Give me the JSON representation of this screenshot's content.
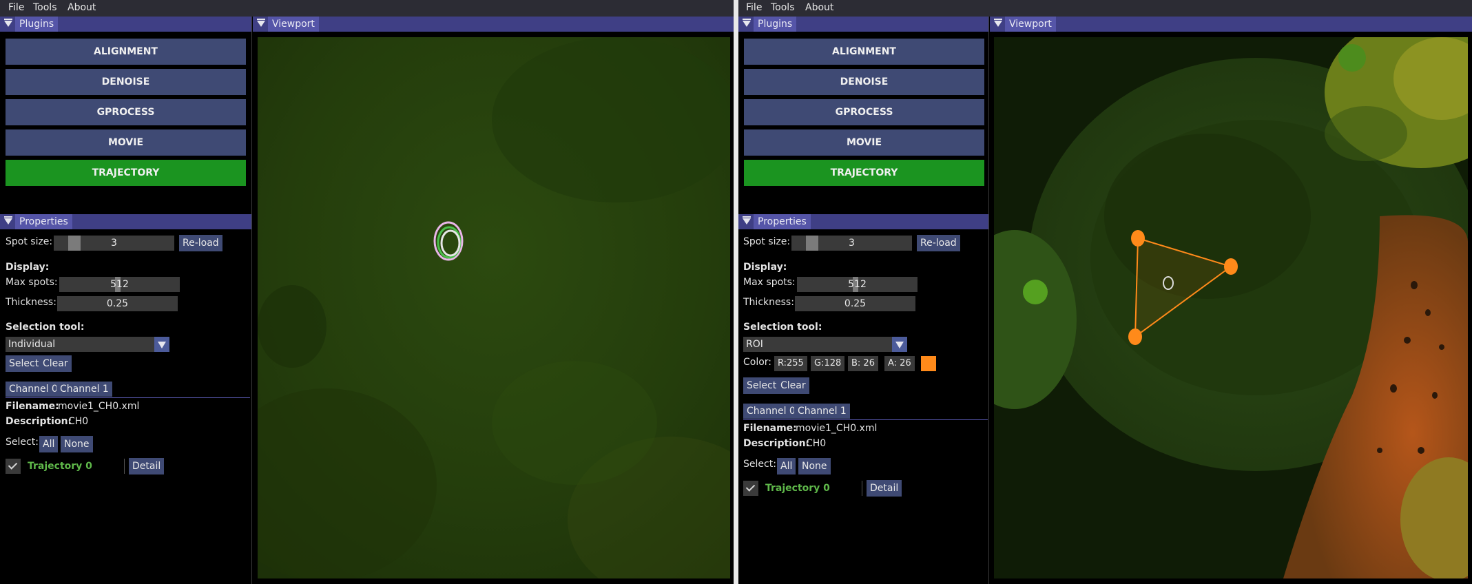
{
  "menu": {
    "file": "File",
    "tools": "Tools",
    "about": "About"
  },
  "windows": {
    "plugins": "Plugins",
    "viewport": "Viewport",
    "properties": "Properties"
  },
  "plugins": [
    "ALIGNMENT",
    "DENOISE",
    "GPROCESS",
    "MOVIE",
    "TRAJECTORY"
  ],
  "active_plugin": "TRAJECTORY",
  "accent_color": "#1b9420",
  "button_color": "#3f4a74",
  "title_color": "#5555a8",
  "left": {
    "spot_size_label": "Spot size:",
    "spot_size_value": "3",
    "reload_label": "Re-load",
    "display_label": "Display:",
    "max_spots_label": "Max spots:",
    "max_spots_value": "512",
    "thickness_label": "Thickness:",
    "thickness_value": "0.25",
    "selection_tool_label": "Selection tool:",
    "selection_tool_value": "Individual",
    "select_label": "Select",
    "clear_label": "Clear",
    "tabs": [
      "Channel 0",
      "Channel 1"
    ],
    "filename_label": "Filename:",
    "filename_value": "movie1_CH0.xml",
    "description_label": "Description:",
    "description_value": "CH0",
    "select_row_label": "Select:",
    "all_label": "All",
    "none_label": "None",
    "trajectory_label": "Trajectory 0",
    "trajectory_checked": true,
    "detail_label": "Detail"
  },
  "right": {
    "spot_size_label": "Spot size:",
    "spot_size_value": "3",
    "reload_label": "Re-load",
    "display_label": "Display:",
    "max_spots_label": "Max spots:",
    "max_spots_value": "512",
    "thickness_label": "Thickness:",
    "thickness_value": "0.25",
    "selection_tool_label": "Selection tool:",
    "selection_tool_value": "ROI",
    "color_label": "Color:",
    "color_r": "R:255",
    "color_g": "G:128",
    "color_b": "B: 26",
    "color_a": "A: 26",
    "roi_color": "#ff8a1a",
    "select_label": "Select",
    "clear_label": "Clear",
    "tabs": [
      "Channel 0",
      "Channel 1"
    ],
    "filename_label": "Filename:",
    "filename_value": "movie1_CH0.xml",
    "description_label": "Description:",
    "description_value": "CH0",
    "select_row_label": "Select:",
    "all_label": "All",
    "none_label": "None",
    "trajectory_label": "Trajectory 0",
    "trajectory_checked": true,
    "detail_label": "Detail"
  }
}
